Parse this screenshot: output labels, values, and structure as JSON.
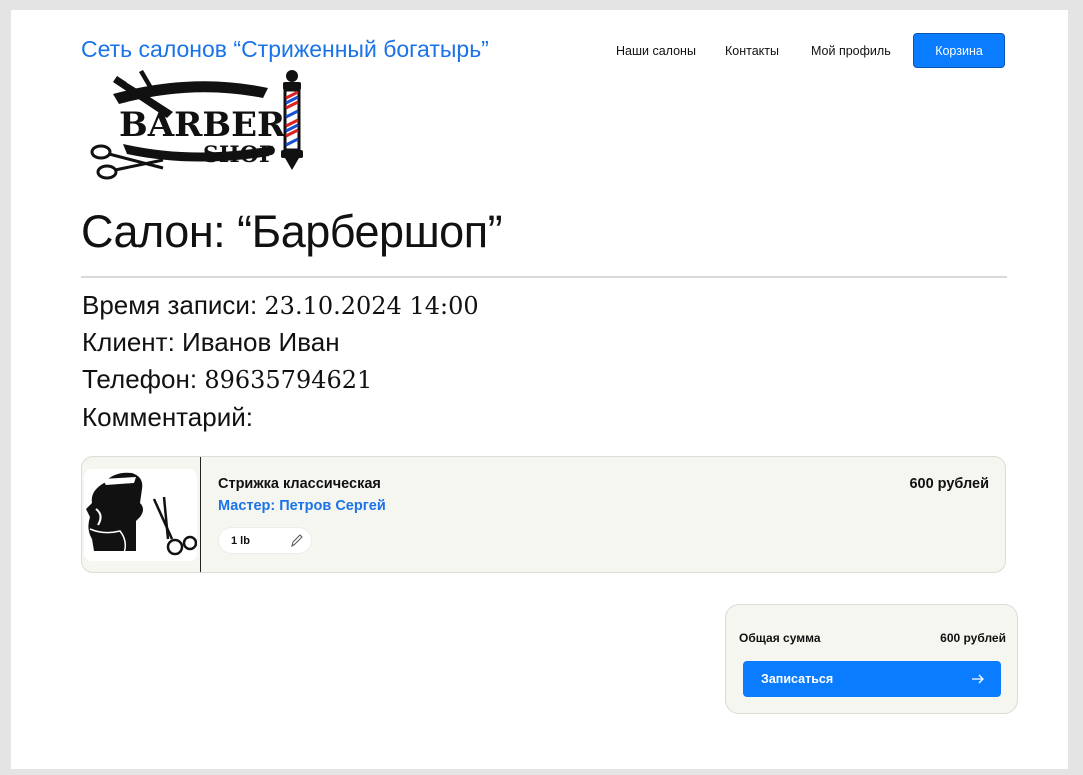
{
  "header": {
    "brand": "Сеть салонов “Стриженный богатырь”",
    "nav": [
      "Наши салоны",
      "Контакты",
      "Мой профиль"
    ],
    "cart_label": "Корзина"
  },
  "logo": {
    "top_text": "BARBER",
    "bottom_text": "SHOP"
  },
  "salon": {
    "title": "Салон: “Барбершоп”"
  },
  "booking": {
    "time_label": "Время записи:",
    "time_value": "23.10.2024 14:00",
    "client_label": "Клиент:",
    "client_value": "Иванов Иван",
    "phone_label": "Телефон:",
    "phone_value": "89635794621",
    "comment_label": "Комментарий:",
    "comment_value": ""
  },
  "service": {
    "name": "Стрижка классическая",
    "master": "Мастер: Петров Сергей",
    "price": "600 рублей",
    "quantity": "1 lb",
    "image_icon": "barber-portrait-icon"
  },
  "summary": {
    "total_label": "Общая сумма",
    "total_value": "600 рублей",
    "book_label": "Записаться"
  },
  "colors": {
    "accent": "#0a7cff",
    "brand_text": "#1a73e8",
    "card_bg": "#f6f6f1"
  }
}
